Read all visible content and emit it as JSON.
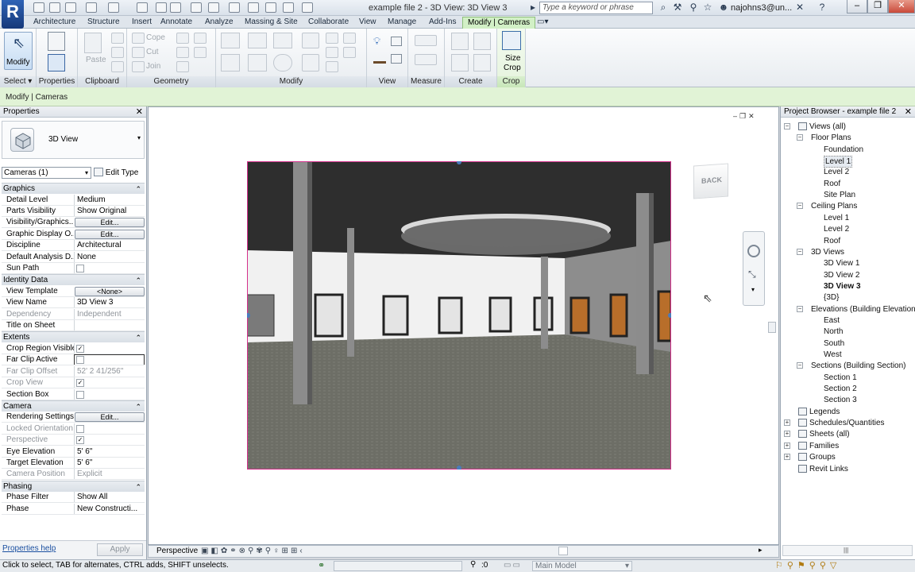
{
  "app": {
    "window_title": "example file 2 - 3D View: 3D View 3",
    "search_placeholder": "Type a keyword or phrase",
    "user": "najohns3@un...",
    "logo_letter": "R"
  },
  "tabs": [
    "Architecture",
    "Structure",
    "Insert",
    "Annotate",
    "Analyze",
    "Massing & Site",
    "Collaborate",
    "View",
    "Manage",
    "Add-Ins",
    "Modify | Cameras"
  ],
  "active_tab": "Modify | Cameras",
  "ribbon": {
    "modify_label": "Modify",
    "panels": [
      "Select",
      "Properties",
      "Clipboard",
      "Geometry",
      "Modify",
      "View",
      "Measure",
      "Create",
      "Crop"
    ],
    "clipboard": {
      "paste": "Paste"
    },
    "geometry": {
      "cope": "Cope",
      "cut": "Cut",
      "join": "Join"
    },
    "crop": {
      "size_crop_line1": "Size",
      "size_crop_line2": "Crop"
    }
  },
  "context_bar": "Modify | Cameras",
  "properties": {
    "title": "Properties",
    "type_name": "3D View",
    "selector": "Cameras (1)",
    "edit_type": "Edit Type",
    "help_link": "Properties help",
    "apply": "Apply",
    "groups": [
      {
        "name": "Graphics",
        "rows": [
          {
            "k": "Detail Level",
            "v": "Medium"
          },
          {
            "k": "Parts Visibility",
            "v": "Show Original"
          },
          {
            "k": "Visibility/Graphics...",
            "btn": "Edit..."
          },
          {
            "k": "Graphic Display O...",
            "btn": "Edit..."
          },
          {
            "k": "Discipline",
            "v": "Architectural"
          },
          {
            "k": "Default Analysis D...",
            "v": "None"
          },
          {
            "k": "Sun Path",
            "chk": ""
          }
        ]
      },
      {
        "name": "Identity Data",
        "rows": [
          {
            "k": "View Template",
            "btn": "<None>"
          },
          {
            "k": "View Name",
            "v": "3D View 3"
          },
          {
            "k": "Dependency",
            "v": "Independent",
            "grey": true
          },
          {
            "k": "Title on Sheet",
            "v": ""
          }
        ]
      },
      {
        "name": "Extents",
        "rows": [
          {
            "k": "Crop Region Visible",
            "chk": "✓"
          },
          {
            "k": "Far Clip Active",
            "chk": "",
            "boxed": true
          },
          {
            "k": "Far Clip Offset",
            "v": "52'  2 41/256\"",
            "grey": true
          },
          {
            "k": "Crop View",
            "chk": "✓",
            "grey": true
          },
          {
            "k": "Section Box",
            "chk": ""
          }
        ]
      },
      {
        "name": "Camera",
        "rows": [
          {
            "k": "Rendering Settings",
            "btn": "Edit..."
          },
          {
            "k": "Locked Orientation",
            "chk": "",
            "grey": true
          },
          {
            "k": "Perspective",
            "chk": "✓",
            "grey": true
          },
          {
            "k": "Eye Elevation",
            "v": "5'  6\""
          },
          {
            "k": "Target Elevation",
            "v": "5'  6\""
          },
          {
            "k": "Camera Position",
            "v": "Explicit",
            "grey": true
          }
        ]
      },
      {
        "name": "Phasing",
        "rows": [
          {
            "k": "Phase Filter",
            "v": "Show All"
          },
          {
            "k": "Phase",
            "v": "New Constructi..."
          }
        ]
      }
    ]
  },
  "viewport": {
    "view_mode": "Perspective",
    "viewcube_face": "BACK"
  },
  "browser": {
    "title": "Project Browser - example file 2",
    "nodes": [
      {
        "label": "Views (all)",
        "depth": 0,
        "exp": "-",
        "icon": true
      },
      {
        "label": "Floor Plans",
        "depth": 1,
        "exp": "-"
      },
      {
        "label": "Foundation",
        "depth": 2
      },
      {
        "label": "Level 1",
        "depth": 2,
        "selected": true
      },
      {
        "label": "Level 2",
        "depth": 2
      },
      {
        "label": "Roof",
        "depth": 2
      },
      {
        "label": "Site Plan",
        "depth": 2
      },
      {
        "label": "Ceiling Plans",
        "depth": 1,
        "exp": "-"
      },
      {
        "label": "Level 1",
        "depth": 2
      },
      {
        "label": "Level 2",
        "depth": 2
      },
      {
        "label": "Roof",
        "depth": 2
      },
      {
        "label": "3D Views",
        "depth": 1,
        "exp": "-"
      },
      {
        "label": "3D View 1",
        "depth": 2
      },
      {
        "label": "3D View 2",
        "depth": 2
      },
      {
        "label": "3D View 3",
        "depth": 2,
        "bold": true
      },
      {
        "label": "{3D}",
        "depth": 2
      },
      {
        "label": "Elevations (Building Elevation)",
        "depth": 1,
        "exp": "-"
      },
      {
        "label": "East",
        "depth": 2
      },
      {
        "label": "North",
        "depth": 2
      },
      {
        "label": "South",
        "depth": 2
      },
      {
        "label": "West",
        "depth": 2
      },
      {
        "label": "Sections (Building Section)",
        "depth": 1,
        "exp": "-"
      },
      {
        "label": "Section 1",
        "depth": 2
      },
      {
        "label": "Section 2",
        "depth": 2
      },
      {
        "label": "Section 3",
        "depth": 2
      },
      {
        "label": "Legends",
        "depth": 0,
        "exp": "",
        "icon": true
      },
      {
        "label": "Schedules/Quantities",
        "depth": 0,
        "exp": "+",
        "icon": true
      },
      {
        "label": "Sheets (all)",
        "depth": 0,
        "exp": "+",
        "icon": true
      },
      {
        "label": "Families",
        "depth": 0,
        "exp": "+",
        "icon": true
      },
      {
        "label": "Groups",
        "depth": 0,
        "exp": "+",
        "icon": true
      },
      {
        "label": "Revit Links",
        "depth": 0,
        "exp": "",
        "icon": true
      }
    ]
  },
  "status": {
    "hint": "Click to select, TAB for alternates, CTRL adds, SHIFT unselects.",
    "zero": ":0",
    "model": "Main Model"
  },
  "colors": {
    "context_green": "#e1f3d6",
    "crop_border": "#d4308c",
    "accent_blue": "#2f63b5"
  }
}
